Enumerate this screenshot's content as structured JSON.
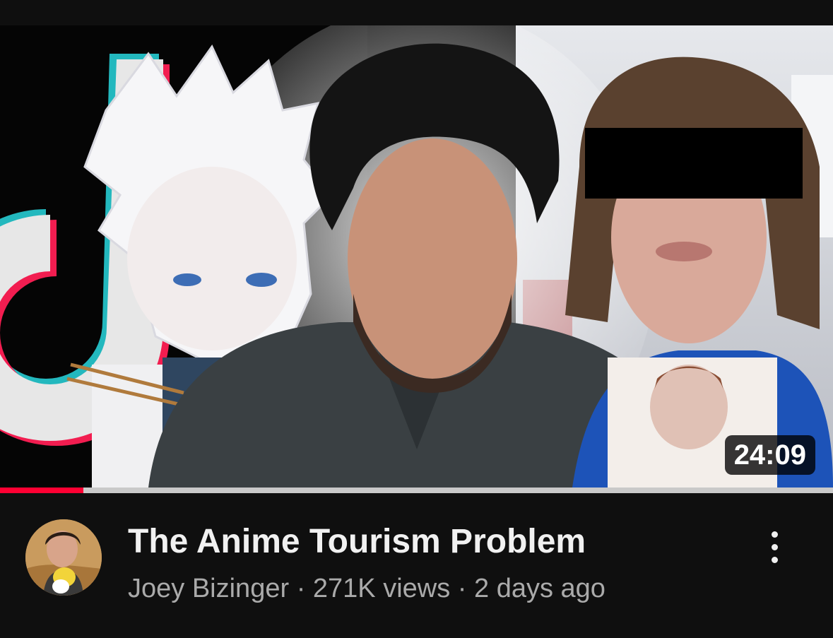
{
  "video": {
    "title": "The Anime Tourism Problem",
    "channel": "Joey Bizinger",
    "separator": "·",
    "views": "271K views",
    "age": "2 days ago",
    "duration": "24:09",
    "watched_fraction": 0.1
  },
  "icons": {
    "more": "more-vert-icon",
    "avatar": "channel-avatar"
  },
  "colors": {
    "background": "#0f0f0f",
    "progress": "#ff0033",
    "title": "#f1f1f1",
    "subtext": "#aaaaaa"
  }
}
